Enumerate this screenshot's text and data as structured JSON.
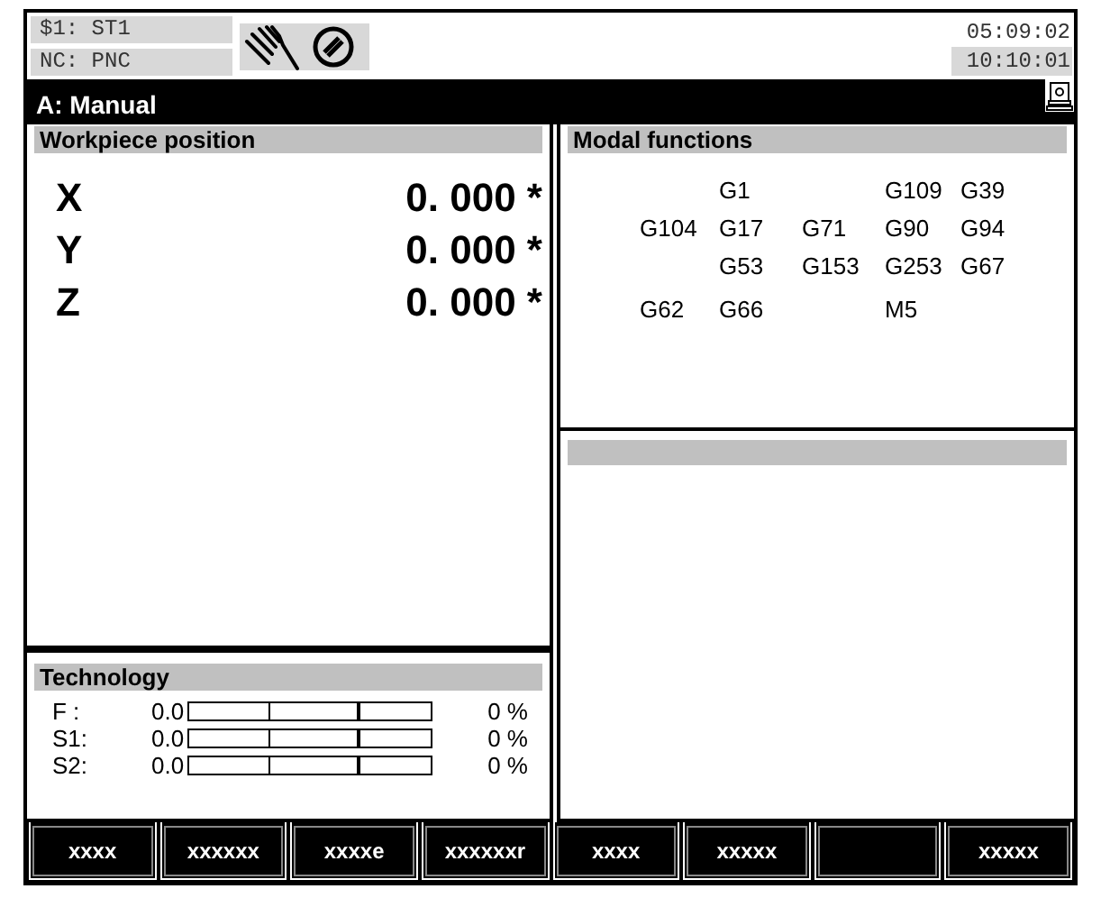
{
  "header": {
    "channel": "$1: ST1",
    "nc": "NC: PNC",
    "time_top": "05:09:02",
    "time_bottom": "10:10:01"
  },
  "mode_bar": {
    "title": "A: Manual"
  },
  "workpiece_position": {
    "title": "Workpiece position",
    "axes": [
      {
        "axis": "X",
        "value": "0. 000 *"
      },
      {
        "axis": "Y",
        "value": "0. 000 *"
      },
      {
        "axis": "Z",
        "value": "0. 000 *"
      }
    ]
  },
  "modal_functions": {
    "title": "Modal functions",
    "rows": [
      [
        null,
        "G1",
        null,
        "G109",
        "G39"
      ],
      [
        "G104",
        "G17",
        "G71",
        "G90",
        "G94"
      ],
      [
        null,
        "G53",
        "G153",
        "G253",
        "G67"
      ],
      [
        "G62",
        "G66",
        null,
        "M5",
        null
      ]
    ]
  },
  "technology": {
    "title": "Technology",
    "rows": [
      {
        "label": "F :",
        "value": "0.0",
        "level": 0,
        "percent": "0 %"
      },
      {
        "label": "S1:",
        "value": "0.0",
        "level": 0,
        "percent": "0 %"
      },
      {
        "label": "S2:",
        "value": "0.0",
        "level": 0,
        "percent": "0 %"
      }
    ]
  },
  "softkeys": [
    {
      "kind": "key",
      "label": "xxxx"
    },
    {
      "kind": "key",
      "label": "xxxxxx"
    },
    {
      "kind": "key",
      "label": "xxxxe"
    },
    {
      "kind": "key",
      "label": "xxxxxxr"
    },
    {
      "kind": "key",
      "label": "xxxx"
    },
    {
      "kind": "key",
      "label": "xxxxx"
    },
    {
      "kind": "blank"
    },
    {
      "kind": "key",
      "label": "xxxxx"
    }
  ]
}
